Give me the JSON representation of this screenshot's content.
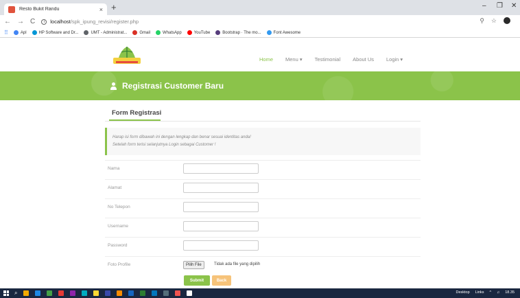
{
  "browser": {
    "tab_title": "Resto Bukit Randu",
    "tab_close": "×",
    "new_tab": "+",
    "controls": {
      "minimize": "–",
      "maximize": "❐",
      "close": "✕"
    },
    "nav": {
      "back": "←",
      "forward": "→",
      "reload": "C"
    },
    "url_host": "localhost",
    "url_path": "/spk_ipung_revisi/register.php",
    "bookmarks": [
      {
        "label": "Apl",
        "color": "#4285f4"
      },
      {
        "label": "HP Software and Dr...",
        "color": "#0096d6"
      },
      {
        "label": "UMT - Administrat...",
        "color": "#5f6368"
      },
      {
        "label": "Gmail",
        "color": "#d93025"
      },
      {
        "label": "WhatsApp",
        "color": "#25d366"
      },
      {
        "label": "YouTube",
        "color": "#ff0000"
      },
      {
        "label": "Bootstrap · The mo...",
        "color": "#563d7c"
      },
      {
        "label": "Font Awesome",
        "color": "#339af0"
      }
    ]
  },
  "site": {
    "nav_items": [
      "Home",
      "Menu ▾",
      "Testimonial",
      "About Us",
      "Login ▾"
    ],
    "banner_title": "Registrasi Customer Baru",
    "form_heading": "Form Registrasi",
    "callout_line1": "Harap isi form dibawah ini dengan lengkap dan benar sesuai identitas anda!",
    "callout_line2": "Setelah form terisi selanjutnya Login sebagai Customer !",
    "fields": [
      {
        "label": "Nama",
        "value": ""
      },
      {
        "label": "Alamat",
        "value": ""
      },
      {
        "label": "No Telepon",
        "value": ""
      },
      {
        "label": "Username",
        "value": ""
      },
      {
        "label": "Password",
        "value": ""
      }
    ],
    "photo_label": "Foto Profile",
    "file_button": "Pilih File",
    "file_status": "Tidak ada file yang dipilih",
    "submit_label": "Submit",
    "back_label": "Back",
    "accent_color": "#8bc34a",
    "back_color": "#f6c37a"
  },
  "taskbar": {
    "desktop_label": "Desktop",
    "links_label": "Links",
    "time": "18.35",
    "app_colors": [
      "#f2a900",
      "#1e88e5",
      "#43a047",
      "#e53935",
      "#8e24aa",
      "#00acc1",
      "#fdd835",
      "#3949ab",
      "#fb8c00",
      "#1565c0",
      "#2e7d32",
      "#0277bd",
      "#546e7a",
      "#ef5350",
      "#ffffff"
    ]
  }
}
